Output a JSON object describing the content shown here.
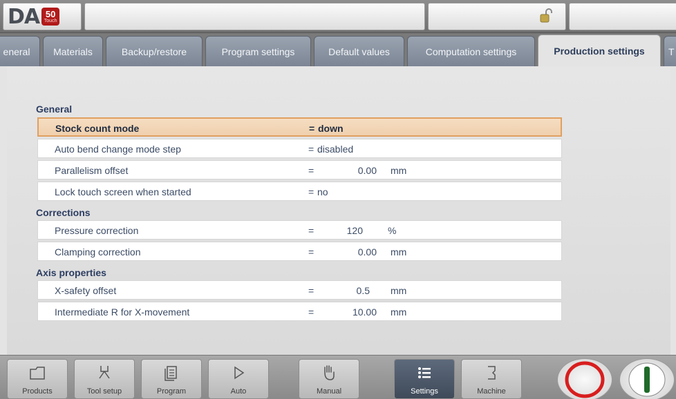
{
  "logo": {
    "brand": "DA",
    "model": "50",
    "edition": "Touch"
  },
  "tabs": [
    {
      "label": "eneral"
    },
    {
      "label": "Materials"
    },
    {
      "label": "Backup/restore"
    },
    {
      "label": "Program settings"
    },
    {
      "label": "Default values"
    },
    {
      "label": "Computation settings"
    },
    {
      "label": "Production settings",
      "active": true
    },
    {
      "label": "T"
    }
  ],
  "groups": {
    "general": "General",
    "corrections": "Corrections",
    "axis": "Axis properties"
  },
  "rows": [
    {
      "label": "Stock count mode",
      "eq": "=",
      "value": "down",
      "unit": ""
    },
    {
      "label": "Auto bend change mode step",
      "eq": "=",
      "value": "disabled",
      "unit": ""
    },
    {
      "label": "Parallelism offset",
      "eq": "=",
      "value": "0.00",
      "unit": "mm"
    },
    {
      "label": "Lock touch screen when started",
      "eq": "=",
      "value": "no",
      "unit": ""
    },
    {
      "label": "Pressure correction",
      "eq": "=",
      "value": "120",
      "unit": "%"
    },
    {
      "label": "Clamping correction",
      "eq": "=",
      "value": "0.00",
      "unit": "mm"
    },
    {
      "label": "X-safety offset",
      "eq": "=",
      "value": "0.5",
      "unit": "mm"
    },
    {
      "label": "Intermediate R for X-movement",
      "eq": "=",
      "value": "10.00",
      "unit": "mm"
    }
  ],
  "nav": [
    {
      "label": "Products",
      "icon": "folder-icon"
    },
    {
      "label": "Tool setup",
      "icon": "tool-icon"
    },
    {
      "label": "Program",
      "icon": "pages-icon"
    },
    {
      "label": "Auto",
      "icon": "play-icon"
    },
    {
      "label": "Manual",
      "icon": "hand-icon"
    },
    {
      "label": "Settings",
      "icon": "list-icon",
      "active": true
    },
    {
      "label": "Machine",
      "icon": "machine-icon"
    }
  ],
  "colors": {
    "accent": "#e0a060",
    "selected_row": "#f3d6b6",
    "stop": "#d81e1e",
    "start": "#1f6a2a"
  }
}
